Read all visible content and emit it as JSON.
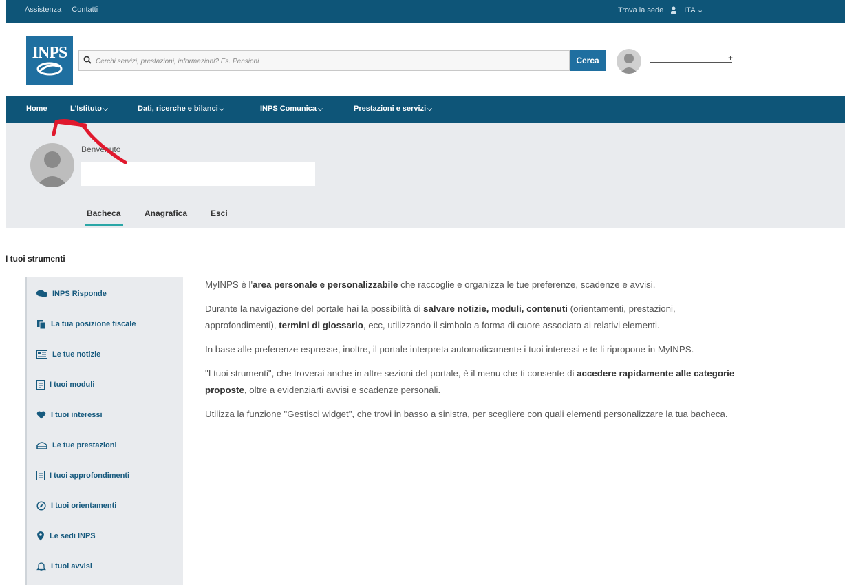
{
  "topbar": {
    "links": [
      "Assistenza",
      "Contatti"
    ],
    "find_office": "Trova la sede",
    "language": "ITA"
  },
  "header": {
    "logo_text": "INPS",
    "search_placeholder": "Cerchi servizi, prestazioni, informazioni? Es. Pensioni",
    "search_button": "Cerca",
    "user_plus": "+"
  },
  "nav": [
    {
      "label": "Home"
    },
    {
      "label": "L'Istituto"
    },
    {
      "label": "Dati, ricerche e bilanci"
    },
    {
      "label": "INPS Comunica"
    },
    {
      "label": "Prestazioni e servizi"
    }
  ],
  "profile": {
    "welcome": "Benvenuto",
    "tabs": [
      "Bacheca",
      "Anagrafica",
      "Esci"
    ]
  },
  "tools": {
    "title": "I tuoi strumenti",
    "items": [
      {
        "label": "INPS Risponde",
        "icon": "chat-icon"
      },
      {
        "label": "La tua posizione fiscale",
        "icon": "document-copy-icon"
      },
      {
        "label": "Le tue notizie",
        "icon": "news-icon"
      },
      {
        "label": "I tuoi moduli",
        "icon": "form-icon"
      },
      {
        "label": "I tuoi interessi",
        "icon": "heart-icon"
      },
      {
        "label": "Le tue prestazioni",
        "icon": "benefits-icon"
      },
      {
        "label": "I tuoi approfondimenti",
        "icon": "article-icon"
      },
      {
        "label": "I tuoi orientamenti",
        "icon": "compass-icon"
      },
      {
        "label": "Le sedi INPS",
        "icon": "location-pin-icon"
      },
      {
        "label": "I tuoi avvisi",
        "icon": "bell-icon"
      }
    ]
  },
  "description": {
    "p1": {
      "a": "MyINPS è l'",
      "b": "area personale e personalizzabile",
      "c": " che raccoglie e organizza le tue preferenze, scadenze e avvisi."
    },
    "p2": {
      "a": "Durante la navigazione del portale hai la possibilità di ",
      "b": "salvare notizie, moduli, contenuti",
      "c": " (orientamenti, prestazioni, approfondimenti), ",
      "d": "termini di glossario",
      "e": ", ecc, utilizzando il simbolo a forma di cuore associato ai relativi elementi."
    },
    "p3": "In base alle preferenze espresse, inoltre, il portale interpreta automaticamente i tuoi interessi e te li ripropone in MyINPS.",
    "p4": {
      "a": "\"I tuoi strumenti\", che troverai anche in altre sezioni del portale, è il menu che ti consente di ",
      "b": "accedere rapidamente alle categorie proposte",
      "c": ", oltre a evidenziarti avvisi e scadenze personali."
    },
    "p5": "Utilizza la funzione \"Gestisci widget\", che trovi in basso a sinistra, per scegliere con quali elementi personalizzare la tua bacheca."
  },
  "colors": {
    "brand_dark": "#0e5578",
    "brand": "#1f6fa0",
    "accent_tab": "#2aa6a6",
    "annotation": "#e0182d"
  }
}
